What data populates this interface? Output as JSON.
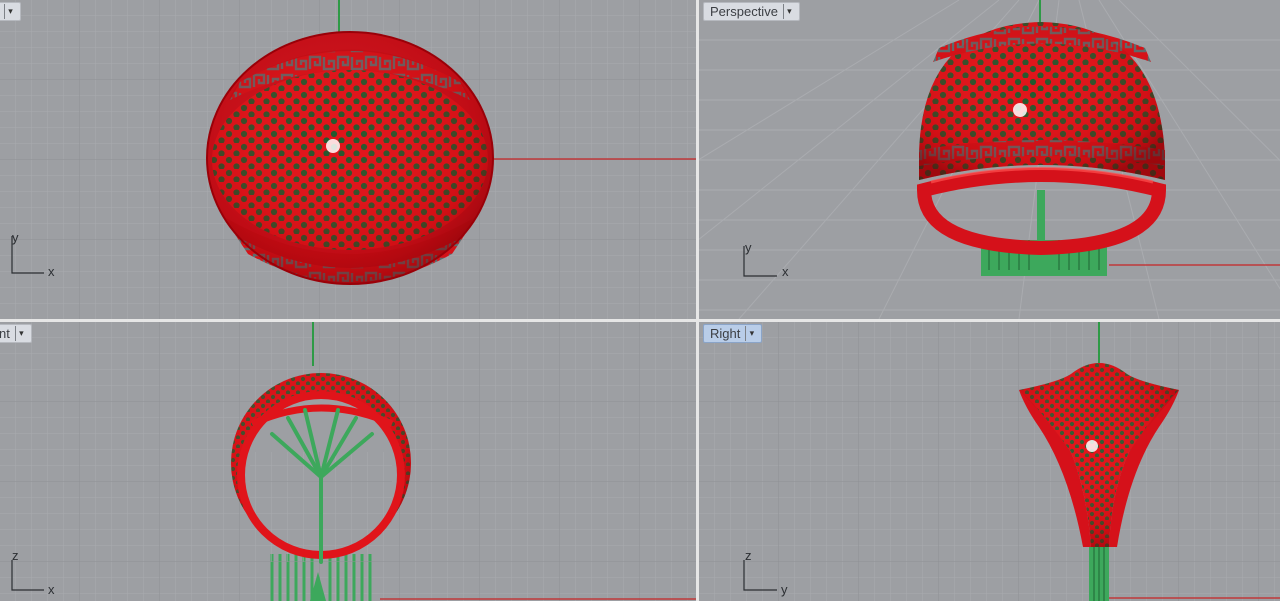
{
  "viewports": {
    "top": {
      "label": "",
      "axis_h": "x",
      "axis_v": "y"
    },
    "perspective": {
      "label": "Perspective",
      "axis_h": "x",
      "axis_v": "y"
    },
    "front": {
      "label": "nt",
      "axis_h": "x",
      "axis_v": "z"
    },
    "right": {
      "label": "Right",
      "axis_h": "y",
      "axis_v": "z"
    }
  },
  "icons": {
    "dropdown": "chevron-down-icon"
  },
  "colors": {
    "background": "#9d9fa3",
    "grid_minor": "#a8aaae",
    "grid_major": "#8c8e92",
    "model_red": "#e0141a",
    "support_green": "#3da85c",
    "axis_red": "#c0393b",
    "axis_green": "#2e9a46"
  }
}
